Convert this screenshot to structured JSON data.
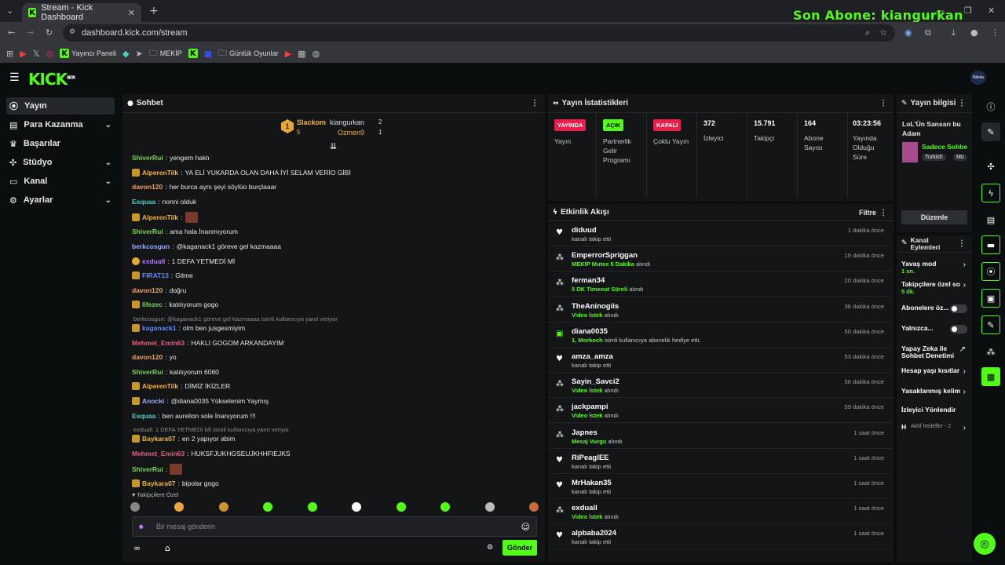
{
  "browser": {
    "tab_title": "Stream - Kick Dashboard",
    "url": "dashboard.kick.com/stream",
    "bookmarks": [
      "Yayıncı Paneli",
      "MEKİP",
      "Günlük Oyunlar"
    ]
  },
  "overlay_text": "Son Abone: kiangurkan",
  "app": {
    "logo": "KICK",
    "logo_tag": "BETA",
    "avatar_label": "Nikola"
  },
  "sidebar": {
    "items": [
      {
        "label": "Yayın",
        "icon": "broadcast-icon",
        "active": true
      },
      {
        "label": "Para Kazanma",
        "icon": "money-icon",
        "expandable": true
      },
      {
        "label": "Başarılar",
        "icon": "trophy-icon"
      },
      {
        "label": "Stüdyo",
        "icon": "studio-icon",
        "expandable": true
      },
      {
        "label": "Kanal",
        "icon": "channel-icon",
        "expandable": true
      },
      {
        "label": "Ayarlar",
        "icon": "gear-icon",
        "expandable": true
      }
    ]
  },
  "chat": {
    "title": "Sohbet",
    "leaderboard": {
      "first_name": "Slackom",
      "first_count": "5",
      "second_name": "kiangurkan",
      "second_count": "2",
      "third_name": "Ozmen9",
      "third_count": "1"
    },
    "messages": [
      {
        "user": "ShiverRui",
        "color": "#7bd35a",
        "text": "yengem haklı"
      },
      {
        "user": "AlperenTilk",
        "color": "#f0b43a",
        "text": "YA ELİ YUKARDA OLAN DAHA İYİ SELAM VERİO GİBİ",
        "badges": true
      },
      {
        "user": "davon120",
        "color": "#f3a060",
        "text": "her burca aynı şeyi söylüo burçlaaar"
      },
      {
        "user": "Esquaa",
        "color": "#4fd1c5",
        "text": "nonni olduk"
      },
      {
        "user": "AlperenTilk",
        "color": "#f0b43a",
        "text": "",
        "badges": true,
        "emote": true
      },
      {
        "user": "ShiverRui",
        "color": "#7bd35a",
        "text": "ama hala İnanmıyorum"
      },
      {
        "user": "berkcosgun",
        "color": "#9ab0ff",
        "text": "@kaganack1 göreve gel kazmaaaa"
      },
      {
        "user": "exduall",
        "color": "#b47bff",
        "text": "1 DEFA YETMEDİ Mİ",
        "sub": true
      },
      {
        "user": "FIRAT13",
        "color": "#5b8cff",
        "text": "Gitme",
        "badges": true
      },
      {
        "user": "davon120",
        "color": "#f3a060",
        "text": "doğru"
      },
      {
        "user": "lifezec",
        "color": "#7bd35a",
        "text": "katılıyorum gogo",
        "badges": true
      },
      {
        "user": "kaganack1",
        "color": "#5b8cff",
        "text": "olm ben jusgesmiyim",
        "badges": true,
        "reply": "berkcosgun: @kaganack1 göreve gel kazmaaaa isimli kullanıcıya yanıt veriyor"
      },
      {
        "user": "Mehmet_Emin63",
        "color": "#e85c7a",
        "text": "HAKLI GOGOM ARKANDAYIM"
      },
      {
        "user": "davon120",
        "color": "#f3a060",
        "text": "yo"
      },
      {
        "user": "ShiverRui",
        "color": "#7bd35a",
        "text": "katılıyorum 6060"
      },
      {
        "user": "AlperenTilk",
        "color": "#f0b43a",
        "text": "DİMİZ İKİZLER",
        "badges": true
      },
      {
        "user": "Anocki",
        "color": "#9ab0ff",
        "text": "@diana0035 Yükselenim Yaymış",
        "badges": true
      },
      {
        "user": "Esquaa",
        "color": "#4fd1c5",
        "text": "ben aurelion sole İnanıyorum !!!"
      },
      {
        "user": "Baykara07",
        "color": "#f0b43a",
        "text": "en 2 yapıyor abim",
        "badges": true,
        "reply": "exduall: 1 DEFA YETMEDİ Mİ isimli kullanıcıya yanıt veriyor"
      },
      {
        "user": "Mehmet_Emin63",
        "color": "#e85c7a",
        "text": "HUKSFJUKHGSEUJKHHFIEJKS"
      },
      {
        "user": "ShiverRui",
        "color": "#7bd35a",
        "text": "",
        "emote": true
      },
      {
        "user": "Baykara07",
        "color": "#f0b43a",
        "text": "bipolar gogo",
        "badges": true
      }
    ],
    "emote_section_label": "Takipçilere Özel",
    "input_placeholder": "Bir mesaj gönderin",
    "send_label": "Gönder"
  },
  "stats": {
    "title": "Yayın İstatistikleri",
    "cards": [
      {
        "pill": "YAYINDA",
        "pill_style": "live",
        "label": "Yayın"
      },
      {
        "pill": "AÇIK",
        "pill_style": "on",
        "label": "Partnerlik Gelir Programı"
      },
      {
        "pill": "KAPALI",
        "pill_style": "off",
        "label": "Çoklu Yayın"
      },
      {
        "value": "372",
        "label": "İzleyici"
      },
      {
        "value": "15.791",
        "label": "Takipçi"
      },
      {
        "value": "164",
        "label": "Abone Sayısı"
      },
      {
        "value": "03:23:56",
        "label": "Yayında Olduğu Süre"
      }
    ]
  },
  "activity": {
    "title": "Etkinlik Akışı",
    "filter_label": "Filtre",
    "items": [
      {
        "name": "diduud",
        "desc": "kanalı takip etti",
        "time": "1 dakika önce",
        "icon": "heart"
      },
      {
        "name": "EmperrorSpriggan",
        "highlight": "MEKİP Mutee 5 Dakika",
        "desc": "alındı",
        "time": "19 dakika önce",
        "icon": "points"
      },
      {
        "name": "ferman34",
        "highlight": "5 DK Timeout Süreli",
        "desc": "alındı",
        "time": "20 dakika önce",
        "icon": "points"
      },
      {
        "name": "TheAninogiis",
        "highlight": "Video İstek",
        "desc": "alındı",
        "time": "36 dakika önce",
        "icon": "points"
      },
      {
        "name": "diana0035",
        "highlight": "1, Morkoch",
        "desc": "isimli kullanıcıya abonelik hediye etti.",
        "time": "50 dakika önce",
        "icon": "gift"
      },
      {
        "name": "amza_amza",
        "desc": "kanalı takip etti",
        "time": "53 dakika önce",
        "icon": "heart"
      },
      {
        "name": "Sayin_Savci2",
        "highlight": "Video İstek",
        "desc": "alındı",
        "time": "56 dakika önce",
        "icon": "points"
      },
      {
        "name": "jackpampi",
        "highlight": "Video İstek",
        "desc": "alındı",
        "time": "59 dakika önce",
        "icon": "points"
      },
      {
        "name": "Japnes",
        "highlight": "Mesaj Vurgu",
        "desc": "alındı",
        "time": "1 saat önce",
        "icon": "points"
      },
      {
        "name": "RiPeaglEE",
        "desc": "kanalı takip etti",
        "time": "1 saat önce",
        "icon": "heart"
      },
      {
        "name": "MrHakan35",
        "desc": "kanalı takip etti",
        "time": "1 saat önce",
        "icon": "heart"
      },
      {
        "name": "exduall",
        "highlight": "Video İstek",
        "desc": "alındı",
        "time": "1 saat önce",
        "icon": "points"
      },
      {
        "name": "alpbaba2024",
        "desc": "kanalı takip etti",
        "time": "1 saat önce",
        "icon": "heart"
      }
    ]
  },
  "stream_info": {
    "title": "Yayın bilgisi",
    "stream_title": "LoL'Ün Sansarı bu Adam",
    "category": "Sadece Sohbe",
    "tags": [
      "Turkish",
      "Mü"
    ],
    "edit_label": "Düzenle"
  },
  "channel_actions": {
    "title": "Kanal Eylemleri",
    "items": [
      {
        "label": "Yavaş mod",
        "sub": "1 sn.",
        "control": "chevron"
      },
      {
        "label": "Takipçilere özel so",
        "sub": "5 dk.",
        "control": "chevron"
      },
      {
        "label": "Abonelere öz...",
        "control": "toggle"
      },
      {
        "label": "Yalnızca...",
        "control": "toggle"
      },
      {
        "label": "Yapay Zeka ile Sohbet Denetimi",
        "control": "external"
      },
      {
        "label": "Hesap yaşı kısıtlar",
        "control": "chevron"
      },
      {
        "label": "Yasaklanmış kelim",
        "control": "chevron"
      },
      {
        "label": "İzleyici Yönlendir",
        "control": "none"
      },
      {
        "label": "H",
        "sub": "Aktif hedefler - 2",
        "control": "chevron"
      }
    ]
  },
  "colors": {
    "accent": "#53fc18",
    "live": "#e91e4c",
    "bg": "#0b0e0f",
    "panel": "#141517"
  }
}
